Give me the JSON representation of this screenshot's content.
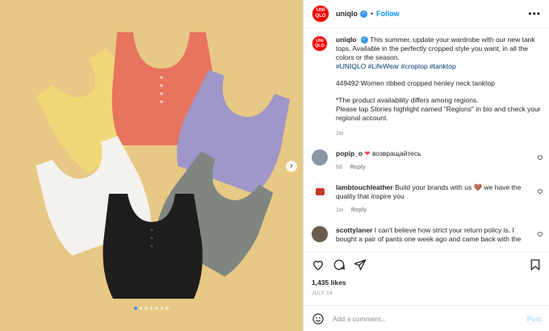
{
  "post": {
    "username": "uniqlo",
    "follow_label": "Follow",
    "avatar_text": "UNI QLO",
    "caption": {
      "username": "uniqlo",
      "text": "This summer, update your wardrobe with our new tank tops. Available in the perfectly cropped style you want, in all the colors or the season.",
      "hashtags": "#UNIQLO #LifeWear #croptop #tanktop",
      "product": "449492 Women ribbed cropped henley neck tanktop",
      "note_line1": "*The product availability differs among regions.",
      "note_line2": "Please tap Stories highlight named \"Regions\" in bio and check your regional account.",
      "time": "1w"
    },
    "comments": [
      {
        "username": "popip_o",
        "text": "возвращайтесь",
        "time": "6d",
        "reply": "Reply",
        "avatar_color": "#8a96a6"
      },
      {
        "username": "lambtouchleather",
        "text": "Build your brands with us 🤎 we have the quality that inspire you",
        "time": "1w",
        "reply": "Reply",
        "avatar_color": "#c0392b"
      },
      {
        "username": "scottylaner",
        "text": "I can't believe how strict your return policy is. I bought a pair of pants one week ago and came back with the",
        "time": "",
        "reply": "",
        "avatar_color": "#6d5b4c"
      }
    ],
    "likes": "1,435 likes",
    "date": "JULY 14",
    "add_comment_placeholder": "Add a comment...",
    "post_label": "Post",
    "carousel": {
      "count": 7,
      "active": 0
    }
  },
  "colors": {
    "background": "#e7c884",
    "tops": [
      "#e8735f",
      "#9f96c9",
      "#7f8680",
      "#1e1e1f",
      "#f4f2ef",
      "#f0d878"
    ],
    "link": "#0095f6",
    "hashtag": "#00376b"
  },
  "icons": [
    "more-icon",
    "verified-icon",
    "heart-icon",
    "comment-icon",
    "share-icon",
    "save-icon",
    "emoji-icon",
    "next-arrow-icon"
  ]
}
